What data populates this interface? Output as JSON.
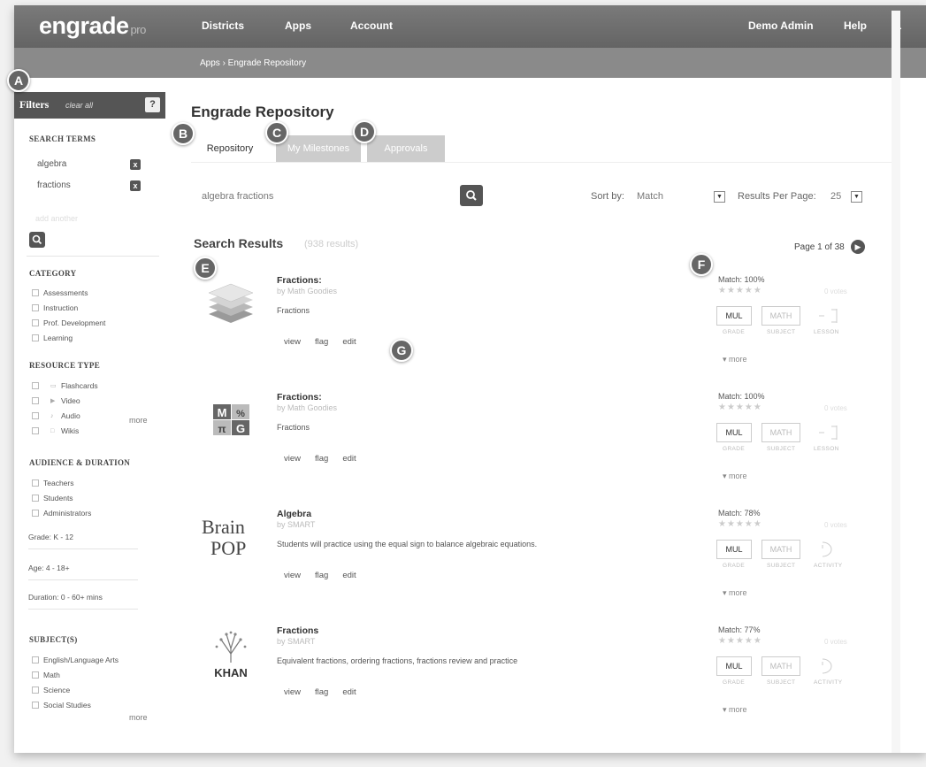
{
  "nav": {
    "logo": "engrade",
    "logo_sub": "pro",
    "links": [
      "Districts",
      "Apps",
      "Account"
    ],
    "user": "Demo Admin",
    "help": "Help",
    "cut": "L",
    "breadcrumb": "Apps › Engrade Repository"
  },
  "markers": [
    "A",
    "B",
    "C",
    "D",
    "E",
    "F",
    "G"
  ],
  "sidebar": {
    "filters_title": "Filters",
    "clear_all": "clear all",
    "help_icon": "?",
    "search_terms_heading": "SEARCH TERMS",
    "terms": [
      "algebra",
      "fractions"
    ],
    "remove_icon": "x",
    "add_term_placeholder": "add another",
    "category_heading": "CATEGORY",
    "categories": [
      "Assessments",
      "Instruction",
      "Prof. Development",
      "Learning"
    ],
    "resource_type_heading": "RESOURCE TYPE",
    "resource_types": [
      "Flashcards",
      "Video",
      "Audio",
      "Wikis"
    ],
    "more": "more",
    "audience_heading": "AUDIENCE & DURATION",
    "audiences": [
      "Teachers",
      "Students",
      "Administrators"
    ],
    "grade_range": "Grade: K - 12",
    "age_range": "Age: 4 - 18+",
    "duration_range": "Duration: 0 - 60+ mins",
    "subjects_heading": "SUBJECT(S)",
    "subjects": [
      "English/Language Arts",
      "Math",
      "Science",
      "Social Studies"
    ]
  },
  "main": {
    "title": "Engrade Repository",
    "tabs": [
      "Repository",
      "My Milestones",
      "Approvals"
    ],
    "search_query": "algebra fractions",
    "sort_by_label": "Sort by:",
    "sort_by_value": "Match",
    "results_per_page_label": "Results Per Page:",
    "results_per_page_value": "25",
    "results_title": "Search Results",
    "results_count": "(938 results)",
    "page_indicator": "Page 1 of 38"
  },
  "results": [
    {
      "title": "Fractions:",
      "author": "by Math Goodies",
      "description": "Fractions",
      "actions": [
        "view",
        "flag",
        "edit"
      ],
      "thumb": "layers-icon",
      "match": "Match: 100%",
      "rating": "0 votes",
      "grade": "MUL",
      "subject": "MATH",
      "type_caption": "LESSON",
      "captions": [
        "GRADE",
        "SUBJECT"
      ],
      "more": "more"
    },
    {
      "title": "Fractions:",
      "author": "by Math Goodies",
      "description": "Fractions",
      "actions": [
        "view",
        "flag",
        "edit"
      ],
      "thumb": "math-goodies-logo",
      "thumb_cells": [
        "M",
        "%",
        "π",
        "G"
      ],
      "match": "Match: 100%",
      "rating": "0 votes",
      "grade": "MUL",
      "subject": "MATH",
      "type_caption": "LESSON",
      "captions": [
        "GRADE",
        "SUBJECT"
      ],
      "more": "more"
    },
    {
      "title": "Algebra",
      "author": "by SMART",
      "description": "Students will practice using the equal sign to balance algebraic equations.",
      "actions": [
        "view",
        "flag",
        "edit"
      ],
      "thumb": "brainpop-logo",
      "thumb_lines": [
        "Brain",
        "POP"
      ],
      "match": "Match: 78%",
      "rating": "0 votes",
      "grade": "MUL",
      "subject": "MATH",
      "type_caption": "ACTIVITY",
      "captions": [
        "GRADE",
        "SUBJECT"
      ],
      "more": "more"
    },
    {
      "title": "Fractions",
      "author": "by SMART",
      "description": "Equivalent fractions, ordering fractions, fractions review and practice",
      "actions": [
        "view",
        "flag",
        "edit"
      ],
      "thumb": "khan-logo",
      "thumb_lines": [
        "KHAN"
      ],
      "match": "Match: 77%",
      "rating": "0 votes",
      "grade": "MUL",
      "subject": "MATH",
      "type_caption": "ACTIVITY",
      "captions": [
        "GRADE",
        "SUBJECT"
      ],
      "more": "more"
    }
  ]
}
